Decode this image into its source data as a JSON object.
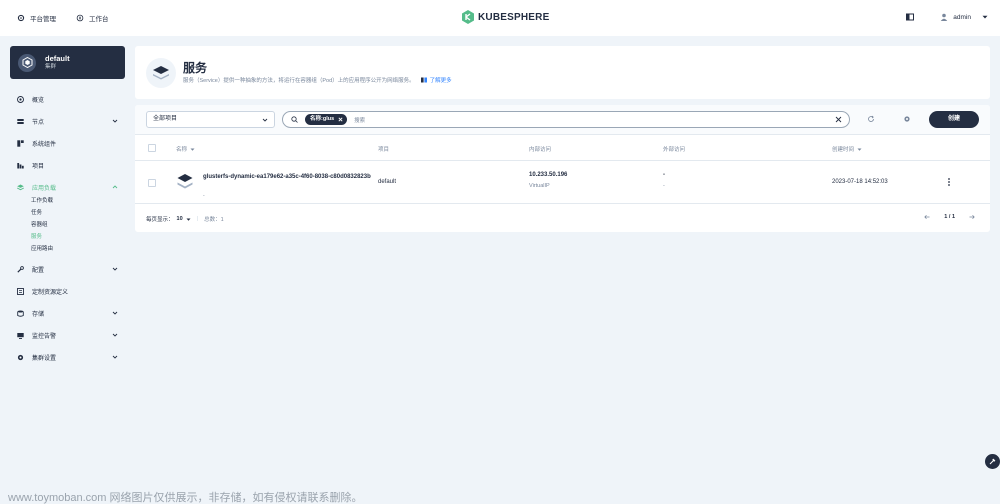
{
  "topbar": {
    "platform_label": "平台管理",
    "workbench_label": "工作台",
    "logo_text": "KUBESPHERE",
    "user_name": "admin"
  },
  "cluster": {
    "name": "default",
    "type": "集群"
  },
  "nav": {
    "overview": "概览",
    "nodes": "节点",
    "components": "系统组件",
    "projects": "项目",
    "workloads_group": "应用负载",
    "sub": {
      "workloads": "工作负载",
      "jobs": "任务",
      "pods": "容器组",
      "services": "服务",
      "routes": "应用路由"
    },
    "config": "配置",
    "crd": "定制资源定义",
    "storage": "存储",
    "monitoring": "监控告警",
    "settings": "集群设置"
  },
  "header": {
    "title": "服务",
    "description": "服务（Service）提供一种抽象的方法，将运行在容器组（Pod）上的应用程序公开为网络服务。",
    "learn_more": "了解更多"
  },
  "toolbar": {
    "project_select": "全部项目",
    "filter_tag": "名称:glus",
    "search_placeholder": "搜索",
    "create_label": "创建"
  },
  "table": {
    "columns": {
      "name": "名称",
      "project": "项目",
      "internal": "内部访问",
      "external": "外部访问",
      "created": "创建时间"
    },
    "rows": [
      {
        "name": "glusterfs-dynamic-ea179e62-a35c-4f60-8038-c80d0832823b",
        "name_sub": "-",
        "project": "default",
        "internal_ip": "10.233.50.196",
        "internal_type": "VirtualIP",
        "external": "-",
        "external_sub": "-",
        "created": "2023-07-18 14:52:03"
      }
    ]
  },
  "pager": {
    "page_size_label": "每页显示：",
    "page_size": "10",
    "total": "总数：1",
    "page": "1 / 1"
  },
  "watermark": "www.toymoban.com 网络图片仅供展示，非存储，如有侵权请联系删除。",
  "colors": {
    "accent": "#55bc8a",
    "dark": "#242e42",
    "background": "#eff4f9"
  }
}
